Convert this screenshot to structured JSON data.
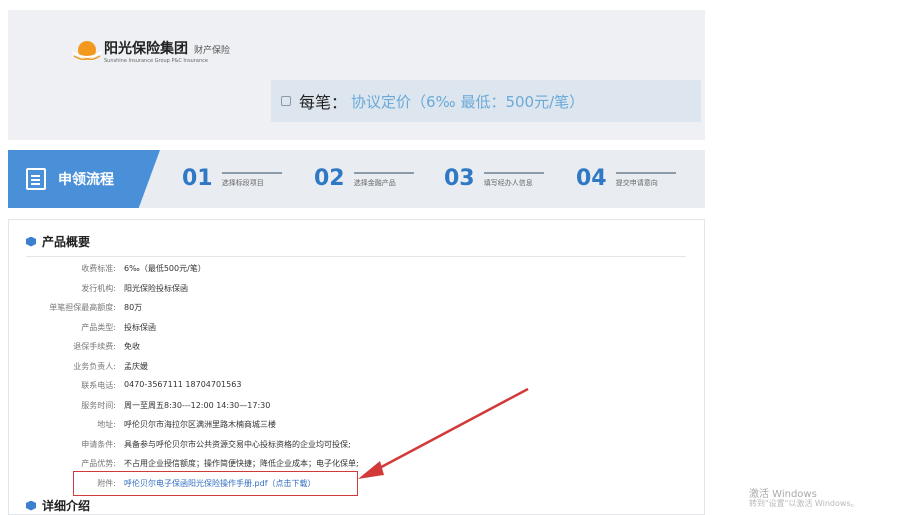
{
  "logo": {
    "name_cn": "阳光保险集团",
    "sub_cn": "财产保险",
    "name_en": "Sunshine Insurance Group  P&C Insurance"
  },
  "price": {
    "label": "每笔：",
    "value": "协议定价（6‰  最低：500元/笔）"
  },
  "steps": {
    "title": "申领流程",
    "items": [
      {
        "num": "01",
        "label": "选择标段项目"
      },
      {
        "num": "02",
        "label": "选择金融产品"
      },
      {
        "num": "03",
        "label": "填写经办人信息"
      },
      {
        "num": "04",
        "label": "提交申请意向"
      }
    ]
  },
  "overview": {
    "title": "产品概要",
    "rows": [
      {
        "k": "收费标准:",
        "v": "6‰（最低500元/笔）"
      },
      {
        "k": "发行机构:",
        "v": "阳光保险投标保函"
      },
      {
        "k": "单笔担保最高额度:",
        "v": "80万"
      },
      {
        "k": "产品类型:",
        "v": "投标保函"
      },
      {
        "k": "退保手续费:",
        "v": "免收"
      },
      {
        "k": "业务负责人:",
        "v": "孟庆媛"
      },
      {
        "k": "联系电话:",
        "v": "0470-3567111 18704701563"
      },
      {
        "k": "服务时间:",
        "v": "周一至周五8:30---12:00 14:30—17:30"
      },
      {
        "k": "地址:",
        "v": "呼伦贝尔市海拉尔区满洲里路木楠商城三楼"
      },
      {
        "k": "申请条件:",
        "v": "具备参与呼伦贝尔市公共资源交易中心投标资格的企业均可投保;"
      },
      {
        "k": "产品优势:",
        "v": "不占用企业授信额度；操作简便快捷；降低企业成本；电子化保单;"
      }
    ],
    "attachment": {
      "k": "附件:",
      "v": "呼伦贝尔电子保函阳光保险操作手册.pdf（点击下载）"
    }
  },
  "detail": {
    "title": "详细介绍"
  },
  "watermark": {
    "line1": "激活 Windows",
    "line2": "转到\"设置\"以激活 Windows。"
  },
  "colors": {
    "accent": "#4a90d9",
    "highlight": "#d23a3a",
    "link": "#2f6fc2"
  }
}
